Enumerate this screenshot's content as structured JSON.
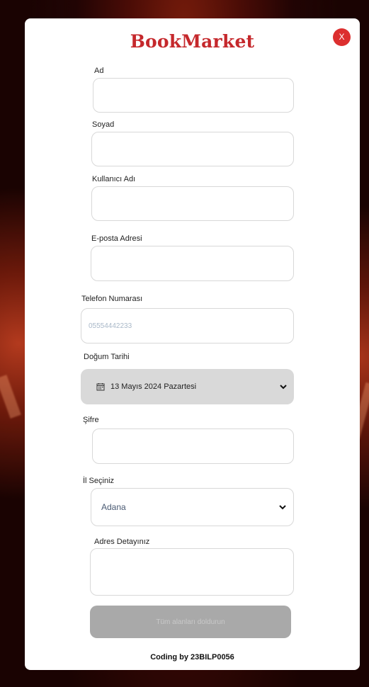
{
  "app": {
    "brand": "BookMarket",
    "close_label": "X"
  },
  "form": {
    "first_name_label": "Ad",
    "last_name_label": "Soyad",
    "username_label": "Kullanıcı Adı",
    "email_label": "E-posta Adresi",
    "phone_label": "Telefon Numarası",
    "phone_placeholder": "05554442233",
    "birthdate_label": "Doğum Tarihi",
    "birthdate_value": "13 Mayıs 2024 Pazartesi",
    "password_label": "Şifre",
    "city_label": "İl Seçiniz",
    "city_value": "Adana",
    "address_label": "Adres Detayınız",
    "submit_label": "Tüm alanları doldurun"
  },
  "footer": {
    "credit": "Coding by 23BILP0056"
  }
}
